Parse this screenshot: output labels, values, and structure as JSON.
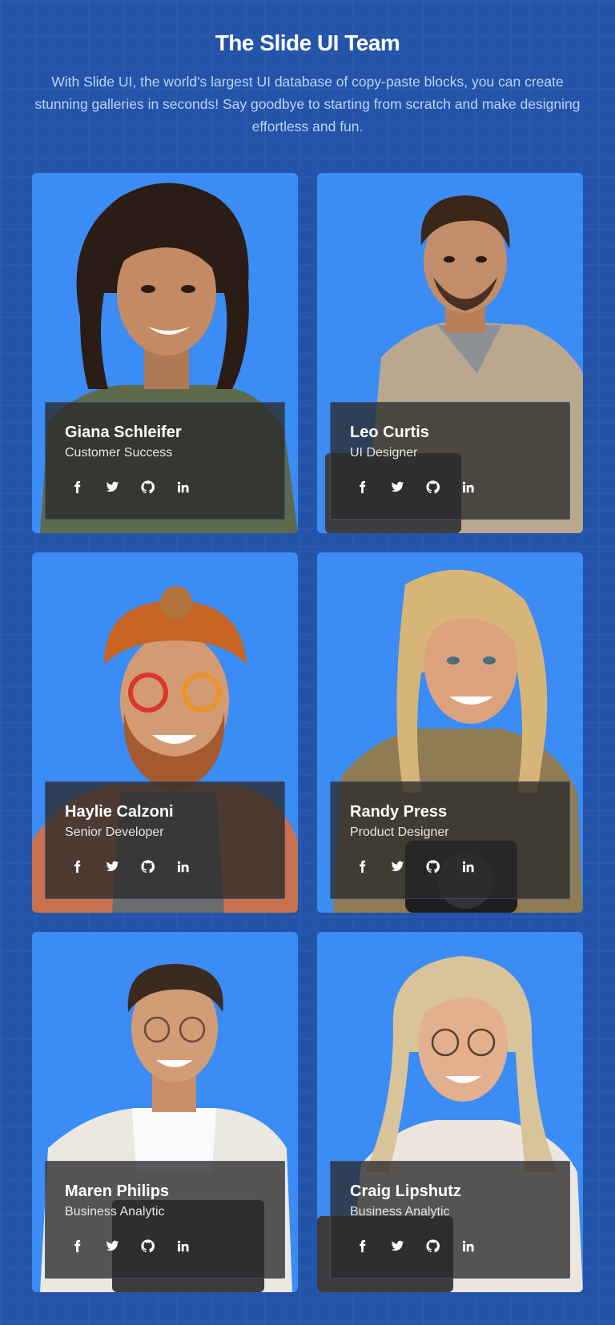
{
  "header": {
    "title": "The Slide UI Team",
    "subtitle": "With Slide UI, the world's largest UI database of copy-paste blocks, you can create stunning galleries in seconds! Say goodbye to starting from scratch and make designing effortless and fun."
  },
  "colors": {
    "page_bg": "#2454a9",
    "card_bg": "#3b8cf4",
    "overlay": "#2a2a2a"
  },
  "social_icons": [
    "facebook-icon",
    "twitter-icon",
    "github-icon",
    "linkedin-icon"
  ],
  "team": [
    {
      "name": "Giana Schleifer",
      "role": "Customer Success"
    },
    {
      "name": "Leo Curtis",
      "role": "UI Designer"
    },
    {
      "name": "Haylie Calzoni",
      "role": "Senior Developer"
    },
    {
      "name": "Randy Press",
      "role": "Product Designer"
    },
    {
      "name": "Maren Philips",
      "role": "Business Analytic"
    },
    {
      "name": "Craig Lipshutz",
      "role": "Business Analytic"
    }
  ]
}
